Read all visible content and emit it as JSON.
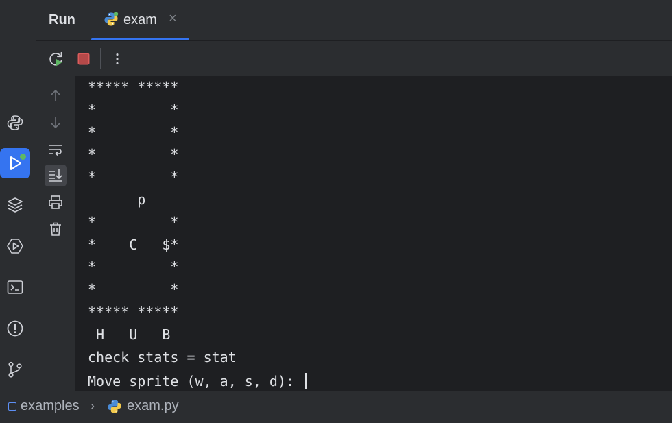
{
  "header": {
    "run_title": "Run",
    "tab": {
      "label": "exam",
      "close": "×"
    }
  },
  "console": {
    "lines": [
      "***** *****",
      "*         *",
      "*         *",
      "*         *",
      "*         *",
      "      p",
      "*         *",
      "*    C   $*",
      "*         *",
      "*         *",
      "***** *****",
      " H   U   B",
      "check stats = stat"
    ],
    "prompt": "Move sprite (w, a, s, d): "
  },
  "breadcrumb": {
    "project": "examples",
    "separator": "›",
    "file": "exam.py"
  },
  "colors": {
    "accent": "#3574f0",
    "run_green": "#5fb865",
    "stop_red": "#db5c5c",
    "python_blue": "#4a8bd6",
    "python_yellow": "#f2c94c"
  },
  "icons": {
    "activity": [
      "python-packages-icon",
      "run-icon",
      "layers-icon",
      "services-icon",
      "terminal-icon",
      "problems-icon",
      "git-icon"
    ],
    "toolbar": [
      "rerun-icon",
      "stop-icon",
      "more-options-icon"
    ],
    "gutter": [
      "scroll-up-icon",
      "scroll-down-icon",
      "soft-wrap-icon",
      "scroll-to-end-icon",
      "print-icon",
      "clear-all-icon"
    ]
  }
}
